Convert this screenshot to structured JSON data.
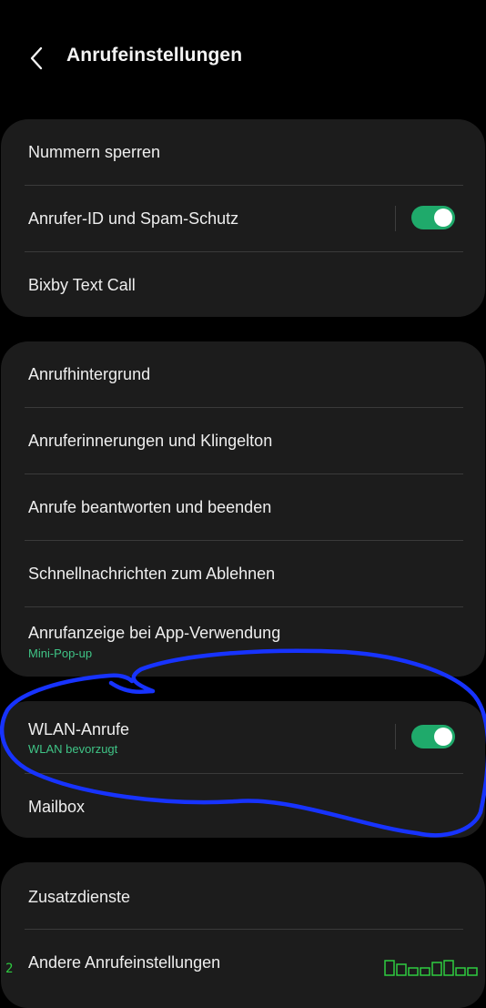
{
  "header": {
    "title": "Anrufeinstellungen",
    "back_icon": "chevron-left-icon"
  },
  "group1": {
    "block_numbers": "Nummern sperren",
    "caller_id": "Anrufer-ID und Spam-Schutz",
    "caller_id_toggle": "on",
    "bixby": "Bixby Text Call"
  },
  "group2": {
    "background": "Anrufhintergrund",
    "reminders": "Anruferinnerungen und Klingelton",
    "answer_end": "Anrufe beantworten und beenden",
    "quick_decline": "Schnellnachrichten zum Ablehnen",
    "display_in_app": "Anrufanzeige bei App-Verwendung",
    "display_in_app_sub": "Mini-Pop-up"
  },
  "group3": {
    "wifi_calling": "WLAN-Anrufe",
    "wifi_calling_sub": "WLAN bevorzugt",
    "wifi_calling_toggle": "on",
    "voicemail": "Mailbox"
  },
  "group4": {
    "supplementary": "Zusatzdienste",
    "other": "Andere Anrufeinstellungen"
  },
  "overlay": {
    "left_number": "2"
  },
  "colors": {
    "background": "#000000",
    "card": "#1c1c1c",
    "accent_green": "#1faa6b",
    "sub_green": "#3fc486",
    "annotation_blue": "#1733ff",
    "overlay_green": "#2ecc40"
  }
}
